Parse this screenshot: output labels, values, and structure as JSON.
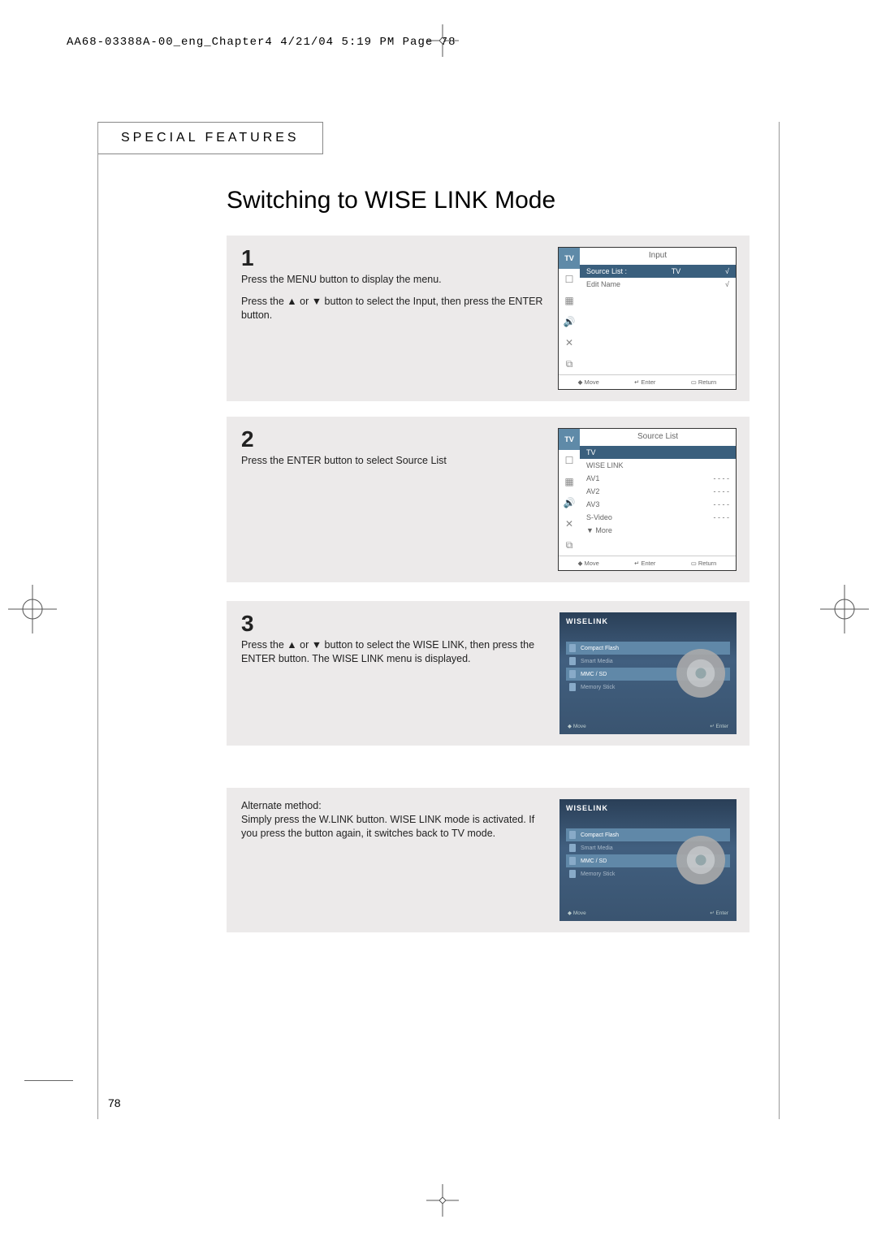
{
  "header": "AA68-03388A-00_eng_Chapter4  4/21/04  5:19 PM  Page 78",
  "section_label": "SPECIAL FEATURES",
  "page_title": "Switching to WISE LINK Mode",
  "page_number": "78",
  "steps": {
    "s1": {
      "num": "1",
      "p1": "Press the MENU button to display the menu.",
      "p2": "Press the ▲ or ▼ button to select the Input, then press the ENTER button."
    },
    "s2": {
      "num": "2",
      "p1": "Press the ENTER button to select Source List"
    },
    "s3": {
      "num": "3",
      "p1": "Press the ▲ or ▼ button to select the WISE LINK, then press the ENTER button. The WISE LINK menu is displayed."
    },
    "alt": {
      "p1": "Alternate method:\nSimply press the W.LINK button. WISE LINK mode is activated. If you press the button again, it switches back to TV mode."
    }
  },
  "osd1": {
    "tab": "TV",
    "title": "Input",
    "rows": {
      "r1_label": "Source List :",
      "r1_value": "TV",
      "r1_arrow": "√",
      "r2_label": "Edit Name",
      "r2_arrow": "√"
    },
    "footer": {
      "move": "Move",
      "enter": "Enter",
      "return": "Return"
    }
  },
  "osd2": {
    "tab": "TV",
    "title": "Source List",
    "rows": {
      "sel": "TV",
      "r2": "WISE LINK",
      "r3l": "AV1",
      "r3v": "- - - -",
      "r4l": "AV2",
      "r4v": "- - - -",
      "r5l": "AV3",
      "r5v": "- - - -",
      "r6l": "S-Video",
      "r6v": "- - - -",
      "r7": "▼ More"
    },
    "footer": {
      "move": "Move",
      "enter": "Enter",
      "return": "Return"
    }
  },
  "wiselink": {
    "logo": "WISELINK",
    "items": {
      "i1": "Compact Flash",
      "i2": "Smart Media",
      "i3": "MMC / SD",
      "i4": "Memory Stick"
    },
    "footer": {
      "move": "Move",
      "enter": "Enter"
    }
  }
}
